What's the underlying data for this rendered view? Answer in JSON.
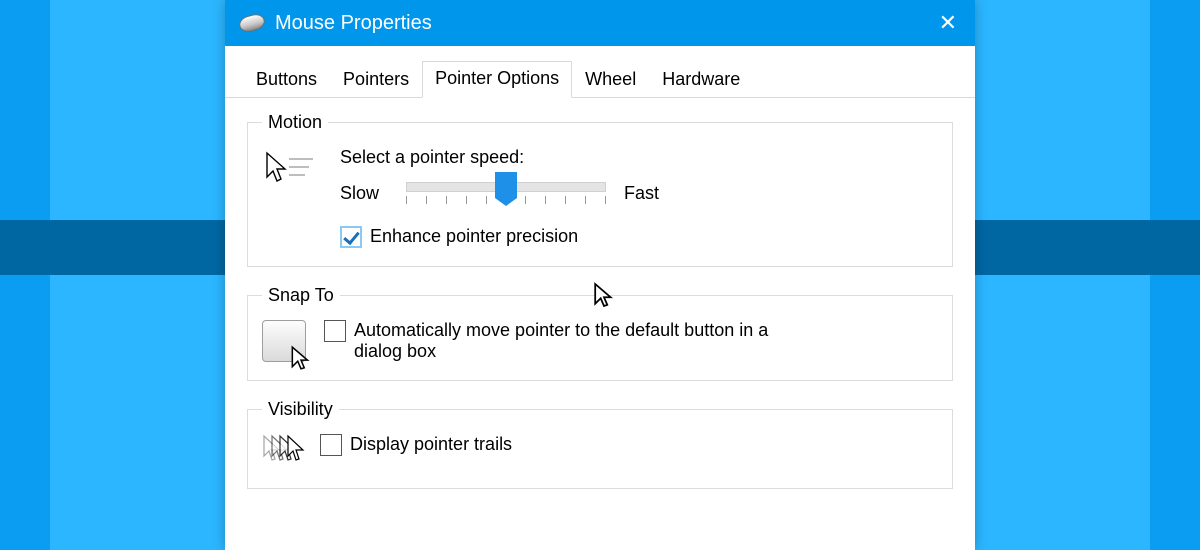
{
  "window": {
    "title": "Mouse Properties"
  },
  "tabs": [
    {
      "label": "Buttons",
      "active": false
    },
    {
      "label": "Pointers",
      "active": false
    },
    {
      "label": "Pointer Options",
      "active": true
    },
    {
      "label": "Wheel",
      "active": false
    },
    {
      "label": "Hardware",
      "active": false
    }
  ],
  "motion": {
    "legend": "Motion",
    "speed_label": "Select a pointer speed:",
    "slow_label": "Slow",
    "fast_label": "Fast",
    "slider": {
      "min": 1,
      "max": 11,
      "value": 6
    },
    "enhance_precision": {
      "label": "Enhance pointer precision",
      "checked": true
    }
  },
  "snap_to": {
    "legend": "Snap To",
    "auto_move": {
      "label": "Automatically move pointer to the default button in a dialog box",
      "checked": false
    }
  },
  "visibility": {
    "legend": "Visibility",
    "pointer_trails": {
      "label": "Display pointer trails",
      "checked": false
    }
  }
}
